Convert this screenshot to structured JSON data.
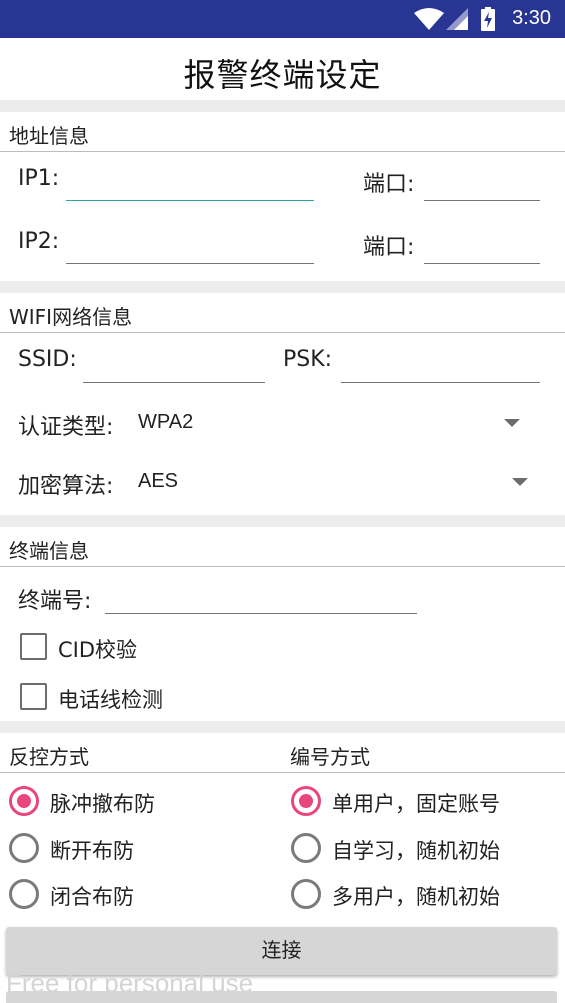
{
  "status_bar": {
    "time": "3:30",
    "icons": [
      "wifi-icon",
      "cell-signal-icon",
      "battery-charging-icon"
    ],
    "color": "#283593"
  },
  "title": "报警终端设定",
  "address": {
    "header": "地址信息",
    "ip1_label": "IP1:",
    "ip1_value": "",
    "port1_label": "端口:",
    "port1_value": "",
    "ip2_label": "IP2:",
    "ip2_value": "",
    "port2_label": "端口:",
    "port2_value": ""
  },
  "wifi": {
    "header": "WIFI网络信息",
    "ssid_label": "SSID:",
    "ssid_value": "",
    "psk_label": "PSK:",
    "psk_value": "",
    "auth_label": "认证类型:",
    "auth_value": "WPA2",
    "enc_label": "加密算法:",
    "enc_value": "AES"
  },
  "terminal": {
    "header": "终端信息",
    "number_label": "终端号:",
    "number_value": "",
    "checkboxes": [
      {
        "label": "CID校验",
        "checked": false
      },
      {
        "label": "电话线检测",
        "checked": false
      }
    ]
  },
  "control": {
    "header": "反控方式",
    "options": [
      {
        "label": "脉冲撤布防",
        "checked": true
      },
      {
        "label": "断开布防",
        "checked": false
      },
      {
        "label": "闭合布防",
        "checked": false
      }
    ]
  },
  "numbering": {
    "header": "编号方式",
    "options": [
      {
        "label": "单用户，固定账号",
        "checked": true
      },
      {
        "label": "自学习，随机初始",
        "checked": false
      },
      {
        "label": "多用户，随机初始",
        "checked": false
      }
    ]
  },
  "connect_label": "连接",
  "watermark": "Free for personal use",
  "colors": {
    "accent": "#e8467c",
    "focus_underline": "#26a69a",
    "button_bg": "#d6d6d6"
  }
}
